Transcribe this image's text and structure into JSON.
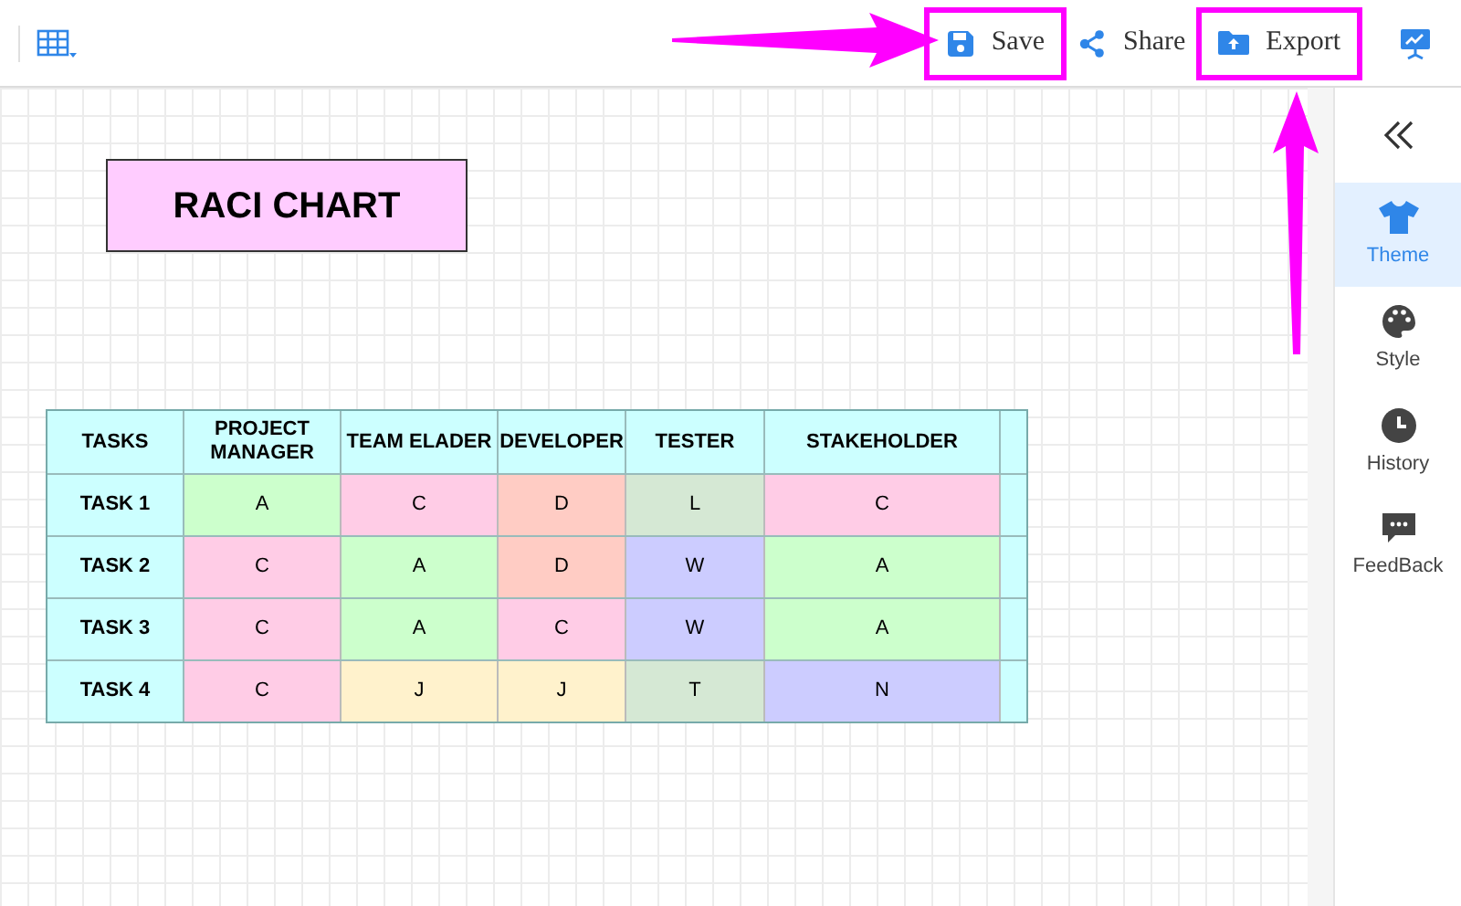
{
  "toolbar": {
    "actions": [
      {
        "kind": "save",
        "label": "Save",
        "highlighted": true
      },
      {
        "kind": "share",
        "label": "Share",
        "highlighted": false
      },
      {
        "kind": "export",
        "label": "Export",
        "highlighted": true
      }
    ]
  },
  "canvas": {
    "title": "RACI CHART",
    "table": {
      "columns": [
        "TASKS",
        "PROJECT MANAGER",
        "TEAM ELADER",
        "DEVELOPER",
        "TESTER",
        "STAKEHOLDER"
      ],
      "rows": [
        {
          "cells": [
            {
              "text": "TASK 1",
              "kind": "task"
            },
            {
              "text": "A",
              "color": "#ccffcc"
            },
            {
              "text": "C",
              "color": "#ffcce6"
            },
            {
              "text": "D",
              "color": "#ffccc4"
            },
            {
              "text": "L",
              "color": "#d5e8d4"
            },
            {
              "text": "C",
              "color": "#ffcce6"
            }
          ]
        },
        {
          "cells": [
            {
              "text": "TASK 2",
              "kind": "task"
            },
            {
              "text": "C",
              "color": "#ffcce6"
            },
            {
              "text": "A",
              "color": "#ccffcc"
            },
            {
              "text": "D",
              "color": "#ffccc4"
            },
            {
              "text": "W",
              "color": "#ccccff"
            },
            {
              "text": "A",
              "color": "#ccffcc"
            }
          ]
        },
        {
          "cells": [
            {
              "text": "TASK 3",
              "kind": "task"
            },
            {
              "text": "C",
              "color": "#ffcce6"
            },
            {
              "text": "A",
              "color": "#ccffcc"
            },
            {
              "text": "C",
              "color": "#ffcce6"
            },
            {
              "text": "W",
              "color": "#ccccff"
            },
            {
              "text": "A",
              "color": "#ccffcc"
            }
          ]
        },
        {
          "cells": [
            {
              "text": "TASK 4",
              "kind": "task"
            },
            {
              "text": "C",
              "color": "#ffcce6"
            },
            {
              "text": "J",
              "color": "#fff2cc"
            },
            {
              "text": "J",
              "color": "#fff2cc"
            },
            {
              "text": "T",
              "color": "#d5e8d4"
            },
            {
              "text": "N",
              "color": "#ccccff"
            }
          ]
        }
      ]
    }
  },
  "sidebar": {
    "items": [
      {
        "kind": "theme",
        "label": "Theme",
        "selected": true
      },
      {
        "kind": "style",
        "label": "Style",
        "selected": false
      },
      {
        "kind": "history",
        "label": "History",
        "selected": false
      },
      {
        "kind": "feedback",
        "label": "FeedBack",
        "selected": false
      }
    ]
  }
}
